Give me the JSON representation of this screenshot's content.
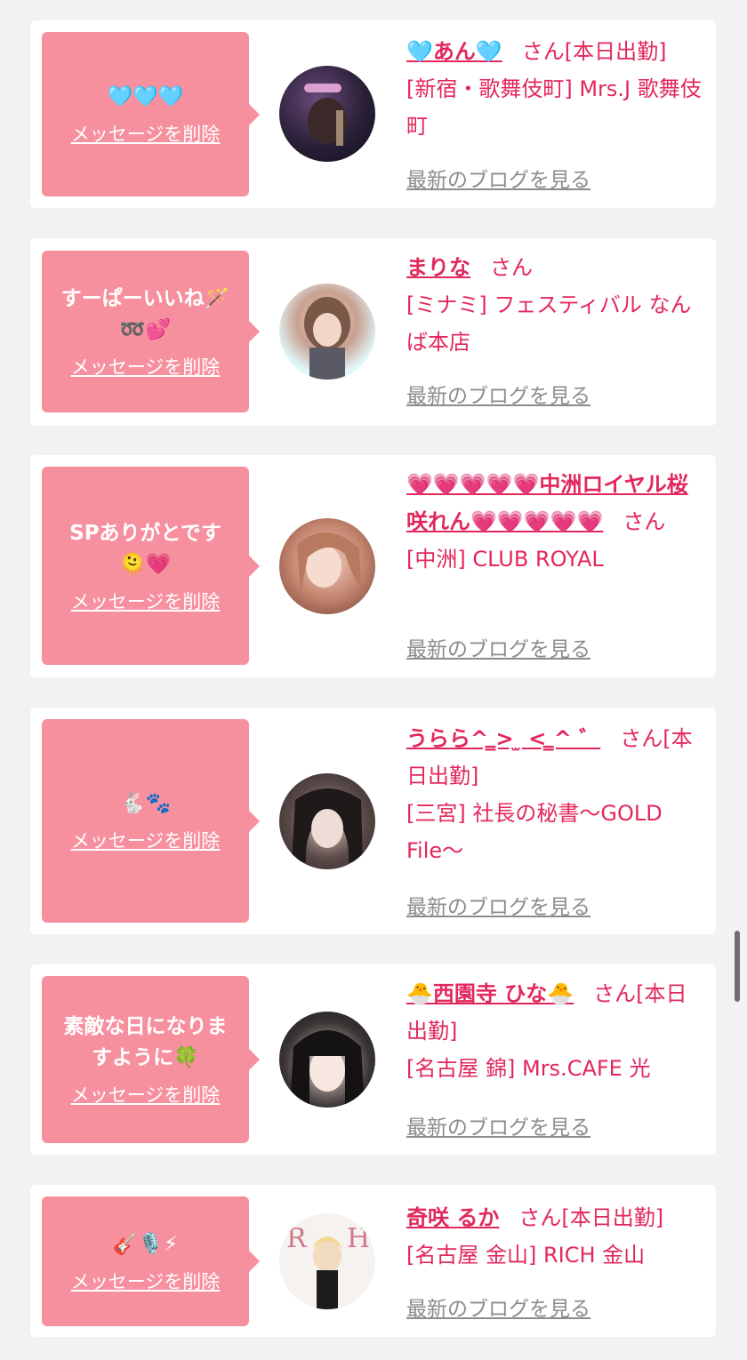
{
  "delete_label": "メッセージを削除",
  "blog_label": "最新のブログを見る",
  "san_label": "さん",
  "accent_color": "#e2285b",
  "bubble_color": "#f6909f",
  "items": [
    {
      "message": "🩵🩵🩵",
      "name": "🩵あん🩵",
      "status": "[本日出勤]",
      "shop": "[新宿・歌舞伎町] Mrs.J 歌舞伎町"
    },
    {
      "message": "すーぱーいいね🪄\n➿💕",
      "name": "まりな",
      "status": "",
      "shop": "[ミナミ] フェスティバル なんば本店"
    },
    {
      "message": "SPありがとです\n🫠💗",
      "name": "💗💗💗💗💗中洲ロイヤル桜咲れん💗💗💗💗💗",
      "status": "",
      "shop": "[中洲] CLUB ROYAL"
    },
    {
      "message": "🐇🐾",
      "name": "うらら^ ̳> ̫ < ̳^ ゛",
      "status": "[本日出勤]",
      "shop": "[三宮] 社長の秘書〜GOLD File〜"
    },
    {
      "message": "素敵な日になりま\nすように🍀",
      "name": "🐣西園寺 ひな🐣",
      "status": "[本日出勤]",
      "shop": "[名古屋 錦] Mrs.CAFE 光"
    },
    {
      "message": "🎸🎙️⚡",
      "name": "奇咲 るか",
      "status": "[本日出勤]",
      "shop": "[名古屋 金山] RICH 金山"
    }
  ]
}
